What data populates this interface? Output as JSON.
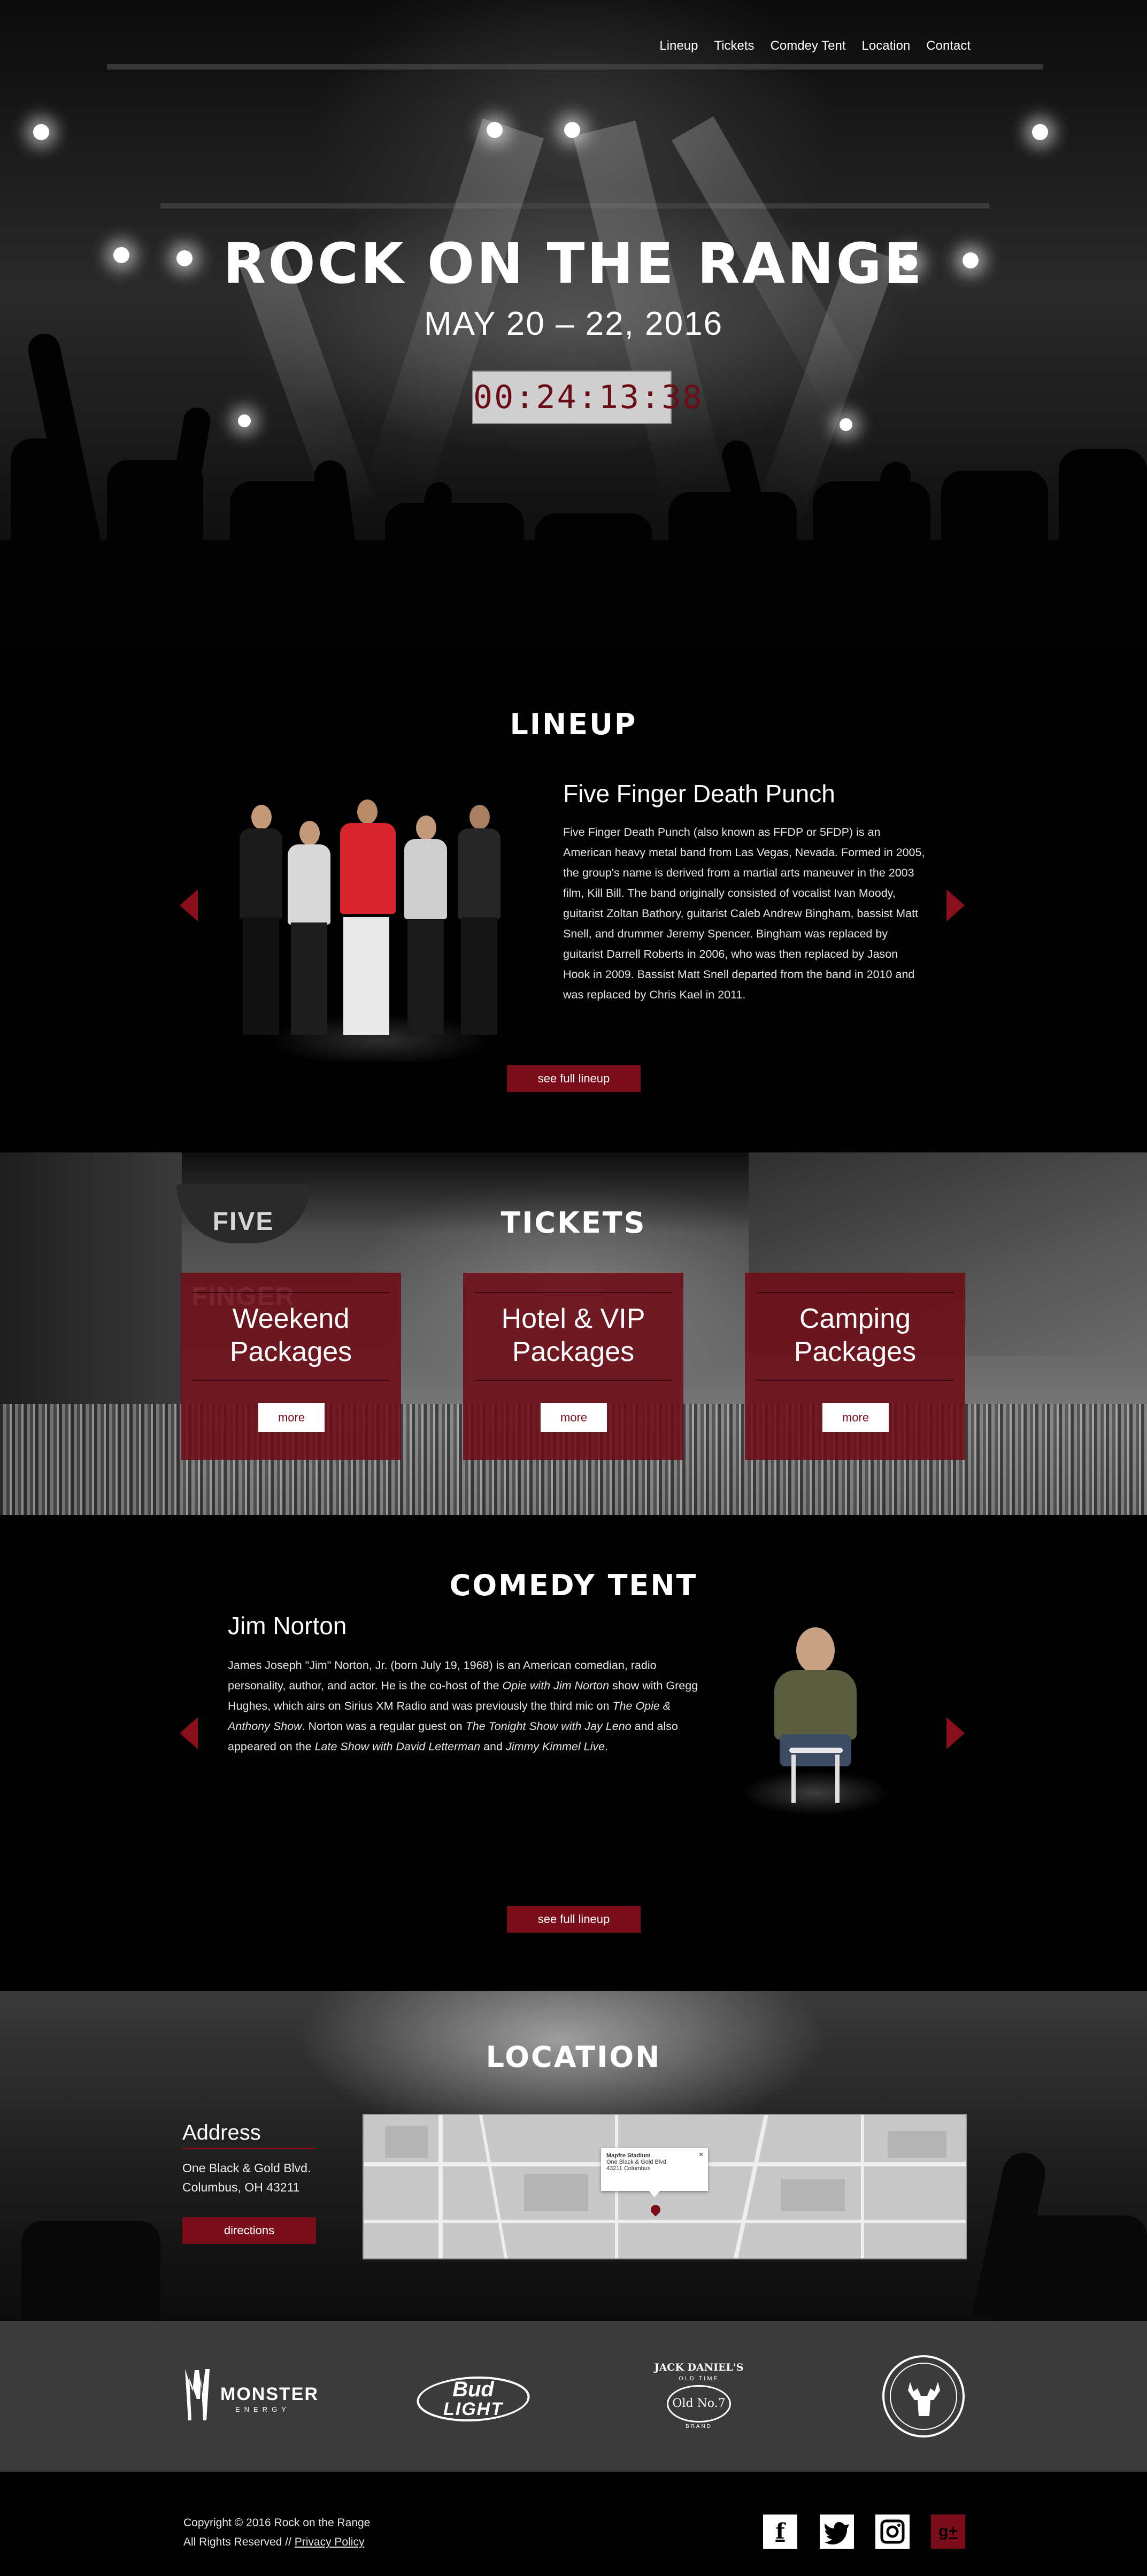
{
  "nav": {
    "items": [
      "Lineup",
      "Tickets",
      "Comdey Tent",
      "Location",
      "Contact"
    ]
  },
  "hero": {
    "title": "ROCK ON THE RANGE",
    "date": "MAY 20 – 22, 2016",
    "countdown": "00:24:13:38"
  },
  "lineup": {
    "title": "LINEUP",
    "act_name": "Five Finger Death Punch",
    "bio": "Five Finger Death Punch (also known as FFDP or 5FDP) is an American heavy metal band from Las Vegas, Nevada. Formed in 2005, the group's name is derived from a martial arts maneuver in the 2003 film, Kill Bill. The band originally consisted of vocalist Ivan Moody, guitarist Zoltan Bathory, guitarist Caleb Andrew Bingham, bassist Matt Snell, and drummer Jeremy Spencer. Bingham was replaced by guitarist Darrell Roberts in 2006, who was then replaced by Jason Hook in 2009. Bassist Matt Snell departed from the band in 2010 and was replaced by Chris Kael in 2011.",
    "cta": "see full lineup"
  },
  "tickets": {
    "title": "TICKETS",
    "cards": [
      {
        "line1": "Weekend",
        "line2": "Packages",
        "button": "more"
      },
      {
        "line1": "Hotel & VIP",
        "line2": "Packages",
        "button": "more"
      },
      {
        "line1": "Camping",
        "line2": "Packages",
        "button": "more"
      }
    ],
    "banner_text": "FIVE FINGER"
  },
  "comedy": {
    "title": "COMEDY TENT",
    "act_name": "Jim Norton",
    "bio_parts": [
      {
        "text": "James Joseph \"Jim\" Norton, Jr. (born July 19, 1968) is an American comedian, radio personality, author, and actor. He is the co-host of the ",
        "italic": false
      },
      {
        "text": "Opie with Jim Norton",
        "italic": true
      },
      {
        "text": " show with Gregg Hughes, which airs on Sirius XM Radio and was previously the third mic on ",
        "italic": false
      },
      {
        "text": "The Opie & Anthony Show",
        "italic": true
      },
      {
        "text": ". Norton was a regular guest on ",
        "italic": false
      },
      {
        "text": "The Tonight Show with Jay Leno",
        "italic": true
      },
      {
        "text": " and also appeared on the ",
        "italic": false
      },
      {
        "text": "Late Show with David Letterman",
        "italic": true
      },
      {
        "text": " and ",
        "italic": false
      },
      {
        "text": "Jimmy Kimmel Live",
        "italic": true
      },
      {
        "text": ".",
        "italic": false
      }
    ],
    "cta": "see full lineup"
  },
  "location": {
    "title": "LOCATION",
    "address_heading": "Address",
    "address_line1": "One Black & Gold Blvd.",
    "address_line2": "Columbus, OH 43211",
    "directions": "directions",
    "map_popup": {
      "name": "Mapfre Stadium",
      "line1": "One Black & Gold Blvd.",
      "line2": "43211 Columbus",
      "close": "×"
    }
  },
  "sponsors": {
    "monster": {
      "word": "MONSTER",
      "sub": "ENERGY"
    },
    "budlight": {
      "line1": "Bud",
      "line2": "LIGHT"
    },
    "jackdaniels": {
      "line1": "JACK DANIEL'S",
      "line2": "OLD TIME",
      "line3": "Old No.7",
      "line4": "BRAND"
    },
    "jagermeister": {
      "glyph": "✝"
    }
  },
  "footer": {
    "copyright": "Copyright © 2016 Rock on the Range",
    "rights": "All Rights Reserved // ",
    "privacy": "Privacy Policy",
    "social": {
      "facebook": "f",
      "twitter": "t",
      "instagram": "◎",
      "googleplus": "g+"
    }
  },
  "colors": {
    "accent": "#7a0d19",
    "arrow": "#8a0f1c",
    "sponsor_bar": "#3b3b3b"
  }
}
